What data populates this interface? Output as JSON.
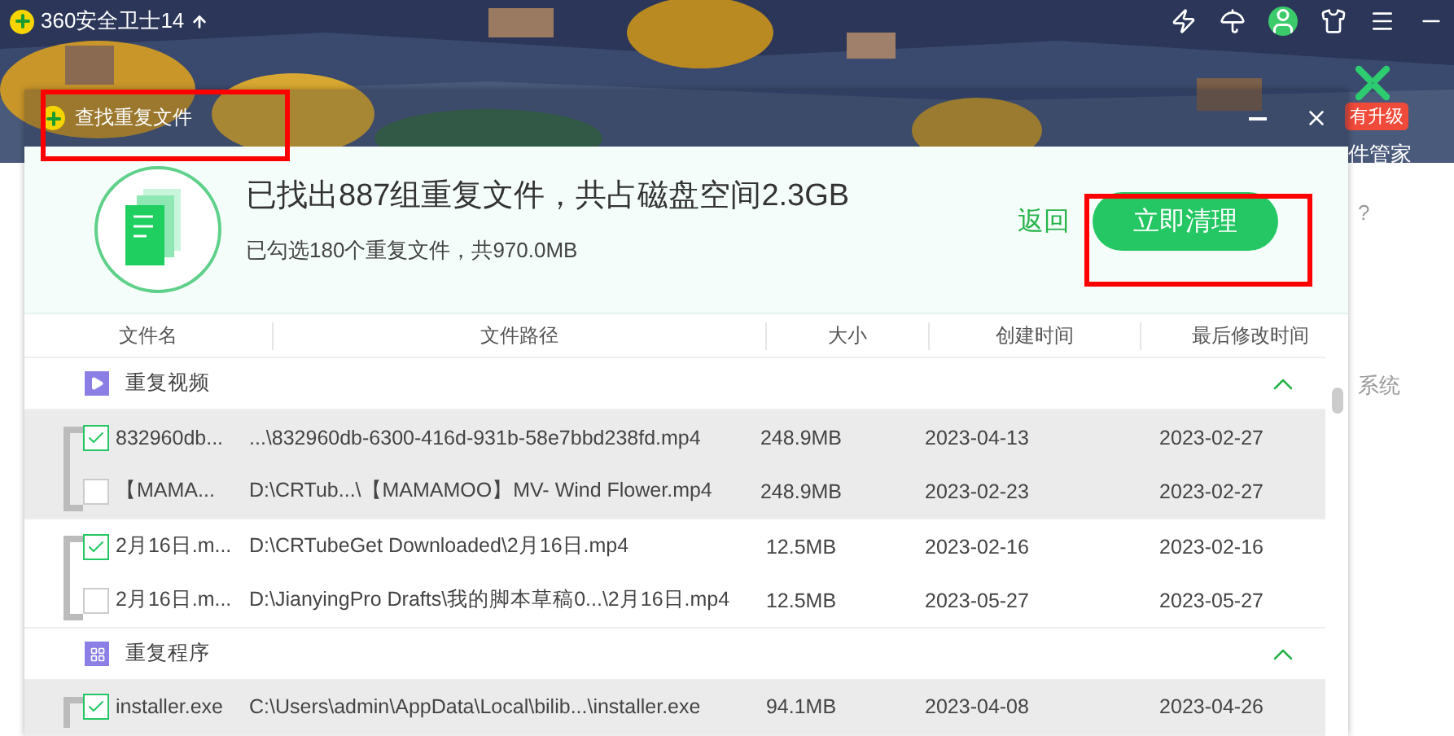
{
  "app": {
    "title": "360安全卫士14"
  },
  "side_panel": {
    "badge": "有升级",
    "tool_label": "件管家",
    "texts": [
      "?",
      "系统"
    ]
  },
  "dialog": {
    "title": "查找重复文件",
    "summary": "已找出887组重复文件，共占磁盘空间2.3GB",
    "selection": "已勾选180个重复文件，共970.0MB",
    "back_link": "返回",
    "clean_button": "立即清理",
    "columns": [
      "文件名",
      "文件路径",
      "大小",
      "创建时间",
      "最后修改时间"
    ],
    "groups": [
      {
        "kind": "video",
        "label": "重复视频",
        "expanded": true,
        "sets": [
          {
            "files": [
              {
                "name": "832960db...",
                "path": "...\\832960db-6300-416d-931b-58e7bbd238fd.mp4",
                "size": "248.9MB",
                "created": "2023-04-13",
                "modified": "2023-02-27",
                "checked": true
              },
              {
                "name": "【MAMA...",
                "path": "D:\\CRTub...\\【MAMAMOO】MV- Wind Flower.mp4",
                "size": "248.9MB",
                "created": "2023-02-23",
                "modified": "2023-02-27",
                "checked": false
              }
            ]
          },
          {
            "files": [
              {
                "name": "2月16日.m...",
                "path": "D:\\CRTubeGet Downloaded\\2月16日.mp4",
                "size": "12.5MB",
                "created": "2023-02-16",
                "modified": "2023-02-16",
                "checked": true
              },
              {
                "name": "2月16日.m...",
                "path": "D:\\JianyingPro Drafts\\我的脚本草稿0...\\2月16日.mp4",
                "size": "12.5MB",
                "created": "2023-05-27",
                "modified": "2023-05-27",
                "checked": false
              }
            ]
          }
        ]
      },
      {
        "kind": "program",
        "label": "重复程序",
        "expanded": true,
        "sets": [
          {
            "files": [
              {
                "name": "installer.exe",
                "path": "C:\\Users\\admin\\AppData\\Local\\bilib...\\installer.exe",
                "size": "94.1MB",
                "created": "2023-04-08",
                "modified": "2023-04-26",
                "checked": true
              }
            ]
          }
        ]
      }
    ]
  }
}
